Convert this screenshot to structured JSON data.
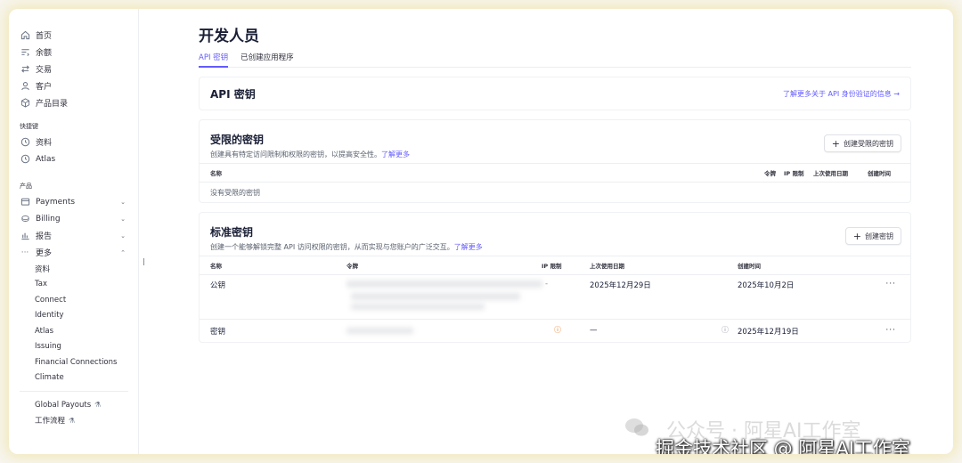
{
  "sidebar": {
    "top_items": [
      {
        "label": "首页",
        "icon": "home-icon"
      },
      {
        "label": "余额",
        "icon": "balance-icon"
      },
      {
        "label": "交易",
        "icon": "transactions-icon"
      },
      {
        "label": "客户",
        "icon": "customer-icon"
      },
      {
        "label": "产品目录",
        "icon": "product-catalog-icon"
      }
    ],
    "shortcuts_label": "快捷键",
    "shortcuts": [
      {
        "label": "资料",
        "icon": "clock-icon"
      },
      {
        "label": "Atlas",
        "icon": "clock-icon"
      }
    ],
    "products_label": "产品",
    "products": [
      {
        "label": "Payments",
        "icon": "payments-icon"
      },
      {
        "label": "Billing",
        "icon": "billing-icon"
      },
      {
        "label": "报告",
        "icon": "reports-icon"
      },
      {
        "label": "更多",
        "icon": "more-icon"
      }
    ],
    "more_items": [
      "资料",
      "Tax",
      "Connect",
      "Identity",
      "Atlas",
      "Issuing",
      "Financial Connections",
      "Climate"
    ],
    "extra_items": [
      "Global Payouts",
      "工作流程"
    ]
  },
  "page": {
    "title": "开发人员",
    "tabs": [
      "API 密钥",
      "已创建应用程序"
    ]
  },
  "api_card": {
    "title": "API 密钥",
    "link": "了解更多关于 API 身份验证的信息 →"
  },
  "restricted": {
    "title": "受限的密钥",
    "desc": "创建具有特定访问限制和权限的密钥，以提高安全性。",
    "more": "了解更多",
    "button": "创建受限的密钥",
    "headers": [
      "名称",
      "令牌",
      "IP 限制",
      "上次使用日期",
      "创建时间"
    ],
    "empty": "没有受限的密钥"
  },
  "standard": {
    "title": "标准密钥",
    "desc": "创建一个能够解锁完整 API 访问权限的密钥，从而实现与您账户的广泛交互。",
    "more": "了解更多",
    "button": "创建密钥",
    "headers": {
      "name": "名称",
      "token": "令牌",
      "ip": "IP 限制",
      "last_used": "上次使用日期",
      "created": "创建时间"
    },
    "rows": [
      {
        "name": "公钥",
        "ip": "-",
        "last_used": "2025年12月29日",
        "created": "2025年10月2日",
        "menu": "···"
      },
      {
        "name": "密钥",
        "ip": "",
        "last_used": "—",
        "created": "2025年12月19日",
        "menu": "···"
      }
    ]
  },
  "watermark": {
    "line1": "公众号 · 阿星AI工作室",
    "line2": "掘金技术社区 @ 阿星AI工作室"
  },
  "colors": {
    "accent": "#635bff",
    "warning": "#e5731b"
  }
}
